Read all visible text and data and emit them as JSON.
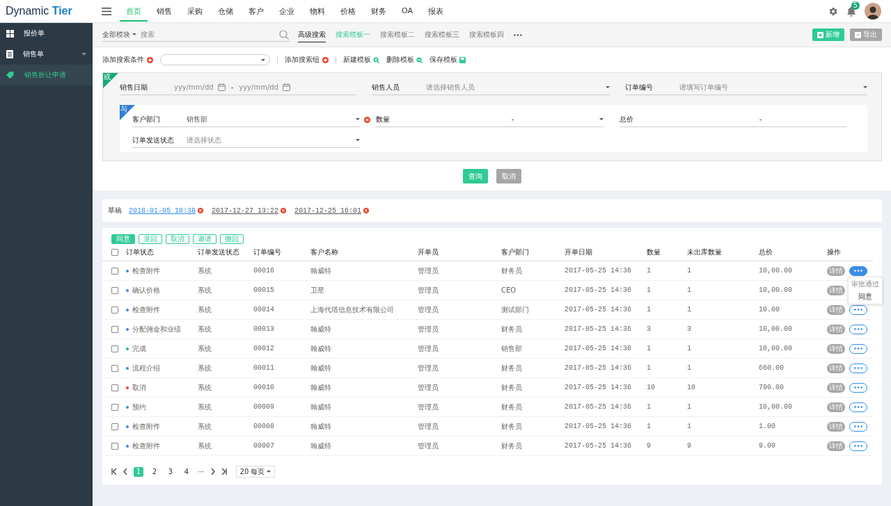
{
  "logo": {
    "text_1": "Dynamic",
    "text_2": "Tier"
  },
  "nav": [
    {
      "label": "首页",
      "selected": true
    },
    {
      "label": "销售",
      "selected": false
    },
    {
      "label": "采购",
      "selected": false
    },
    {
      "label": "仓储",
      "selected": false
    },
    {
      "label": "客户",
      "selected": false
    },
    {
      "label": "企业",
      "selected": false
    },
    {
      "label": "物料",
      "selected": false
    },
    {
      "label": "价格",
      "selected": false
    },
    {
      "label": "财务",
      "selected": false
    },
    {
      "label": "OA",
      "selected": false
    },
    {
      "label": "报表",
      "selected": false
    }
  ],
  "notifications": {
    "badge": "5"
  },
  "sidebar": {
    "items": [
      {
        "label": "报价单",
        "kind": "grid",
        "selected": false,
        "expandable": false
      },
      {
        "label": "销售单",
        "kind": "list",
        "selected": false,
        "expandable": true
      },
      {
        "label": "销售折让申请",
        "kind": "tag",
        "selected": true,
        "expandable": false
      }
    ]
  },
  "search_bar": {
    "module": "全部模块",
    "placeholder": "搜索",
    "tabs": [
      {
        "label": "高级搜索",
        "selected": true,
        "active": false
      },
      {
        "label": "搜索模板一",
        "selected": false,
        "active": true
      },
      {
        "label": "搜索模板二",
        "selected": false,
        "active": false
      },
      {
        "label": "搜索模板三",
        "selected": false,
        "active": false
      },
      {
        "label": "搜索模板四",
        "selected": false,
        "active": false
      }
    ],
    "buttons": [
      {
        "label": "新增",
        "disabled": false
      },
      {
        "label": "导出",
        "disabled": true
      }
    ]
  },
  "conditions": {
    "add_condition": "添加搜索条件",
    "add_group": "添加搜索组",
    "actions": [
      {
        "label": "新建模板",
        "kind": "add"
      },
      {
        "label": "删除模板",
        "kind": "remove"
      },
      {
        "label": "保存模板",
        "kind": "save"
      }
    ]
  },
  "filter": {
    "tag": "或",
    "fields": [
      {
        "label": "销售日期",
        "kind": "date_range",
        "from_placeholder": "yyy/mm/dd",
        "separator": "-",
        "to_placeholder": "yyy/mm/dd"
      },
      {
        "label": "销售人员",
        "kind": "select",
        "placeholder": "请选择销售人员"
      },
      {
        "label": "订单编号",
        "kind": "select",
        "placeholder": "请填写订单编号"
      }
    ],
    "group": {
      "tag": "与",
      "fields": [
        {
          "label": "客户部门",
          "kind": "select",
          "value": "销售部",
          "removable": true
        },
        {
          "label": "数量",
          "kind": "range_select",
          "separator": "-"
        },
        {
          "label": "总价",
          "kind": "range",
          "separator": "-"
        },
        {
          "label": "订单发送状态",
          "kind": "select",
          "placeholder": "请选择状态"
        }
      ]
    },
    "buttons": [
      {
        "label": "查询",
        "disabled": false
      },
      {
        "label": "取消",
        "disabled": true
      }
    ]
  },
  "drafts": {
    "label": "草稿",
    "items": [
      {
        "text": "2018-01-05 10:38",
        "selected": true
      },
      {
        "text": "2017-12-27 13:22",
        "selected": false
      },
      {
        "text": "2017-12-25 16:01",
        "selected": false
      }
    ]
  },
  "actions": [
    {
      "label": "同意",
      "primary": true
    },
    {
      "label": "退回",
      "primary": false
    },
    {
      "label": "取消",
      "primary": false
    },
    {
      "label": "邀请",
      "primary": false
    },
    {
      "label": "撤回",
      "primary": false
    }
  ],
  "table": {
    "select_all": {
      "checked": false
    },
    "columns": [
      "订单状态",
      "订单发送状态",
      "订单编号",
      "客户名称",
      "开单员",
      "客户部门",
      "开单日期",
      "数量",
      "未出库数量",
      "总价",
      "操作"
    ],
    "rows": [
      {
        "checked": false,
        "status": "检查附件",
        "color": "#2d8cf0",
        "send": "系统",
        "no": "00016",
        "customer": "翰威特",
        "creator": "管理员",
        "dept": "财务员",
        "date": "2017-05-25 14:36",
        "qty": "1",
        "pending": "1",
        "total": "10,00.00",
        "detail": "详情",
        "menu_open": true
      },
      {
        "checked": false,
        "status": "确认价格",
        "color": "#2d8cf0",
        "send": "系统",
        "no": "00015",
        "customer": "卫星",
        "creator": "管理员",
        "dept": "CEO",
        "date": "2017-05-25 14:36",
        "qty": "1",
        "pending": "1",
        "total": "10,00.00",
        "detail": "详情",
        "menu_open": false
      },
      {
        "checked": false,
        "status": "检查附件",
        "color": "#2d8cf0",
        "send": "系统",
        "no": "00014",
        "customer": "上海代塔信息技术有限公司",
        "creator": "管理员",
        "dept": "测试部门",
        "date": "2017-05-25 14:36",
        "qty": "1",
        "pending": "1",
        "total": "10.00",
        "detail": "详情",
        "menu_open": false
      },
      {
        "checked": false,
        "status": "分配佣金和业绩",
        "color": "#2d8cf0",
        "send": "系统",
        "no": "00013",
        "customer": "翰威特",
        "creator": "管理员",
        "dept": "财务员",
        "date": "2017-05-25 14:36",
        "qty": "3",
        "pending": "3",
        "total": "10,00.00",
        "detail": "详情",
        "menu_open": false
      },
      {
        "checked": false,
        "status": "完成",
        "color": "#19be6b",
        "send": "系统",
        "no": "00012",
        "customer": "翰威特",
        "creator": "管理员",
        "dept": "销售部",
        "date": "2017-05-25 14:36",
        "qty": "1",
        "pending": "1",
        "total": "10,00.00",
        "detail": "详情",
        "menu_open": false
      },
      {
        "checked": false,
        "status": "流程介绍",
        "color": "#2d8cf0",
        "send": "系统",
        "no": "00011",
        "customer": "翰威特",
        "creator": "管理员",
        "dept": "财务员",
        "date": "2017-05-25 14:36",
        "qty": "1",
        "pending": "1",
        "total": "660.00",
        "detail": "详情",
        "menu_open": false
      },
      {
        "checked": false,
        "status": "取消",
        "color": "#ed4014",
        "send": "系统",
        "no": "00010",
        "customer": "翰威特",
        "creator": "管理员",
        "dept": "财务员",
        "date": "2017-05-25 14:36",
        "qty": "10",
        "pending": "10",
        "total": "790.00",
        "detail": "详情",
        "menu_open": false
      },
      {
        "checked": false,
        "status": "预约",
        "color": "#2d8cf0",
        "send": "系统",
        "no": "00009",
        "customer": "翰威特",
        "creator": "管理员",
        "dept": "财务员",
        "date": "2017-05-25 14:36",
        "qty": "1",
        "pending": "1",
        "total": "10,00.00",
        "detail": "详情",
        "menu_open": false
      },
      {
        "checked": false,
        "status": "检查附件",
        "color": "#2d8cf0",
        "send": "系统",
        "no": "00008",
        "customer": "翰威特",
        "creator": "管理员",
        "dept": "财务员",
        "date": "2017-05-25 14:36",
        "qty": "1",
        "pending": "1",
        "total": "1.00",
        "detail": "详情",
        "menu_open": false
      },
      {
        "checked": false,
        "status": "检查附件",
        "color": "#2d8cf0",
        "send": "系统",
        "no": "00007",
        "customer": "翰威特",
        "creator": "管理员",
        "dept": "财务员",
        "date": "2017-05-25 14:36",
        "qty": "9",
        "pending": "9",
        "total": "9.00",
        "detail": "详情",
        "menu_open": false
      }
    ],
    "menu": [
      {
        "label": "审批通过",
        "disabled": true
      },
      {
        "label": "同意",
        "disabled": false
      }
    ]
  },
  "pagination": {
    "pages": [
      {
        "label": "1",
        "selected": true
      },
      {
        "label": "2",
        "selected": false
      },
      {
        "label": "3",
        "selected": false
      },
      {
        "label": "4",
        "selected": false
      }
    ],
    "ellipsis": "···",
    "page_size": "20 每页"
  }
}
